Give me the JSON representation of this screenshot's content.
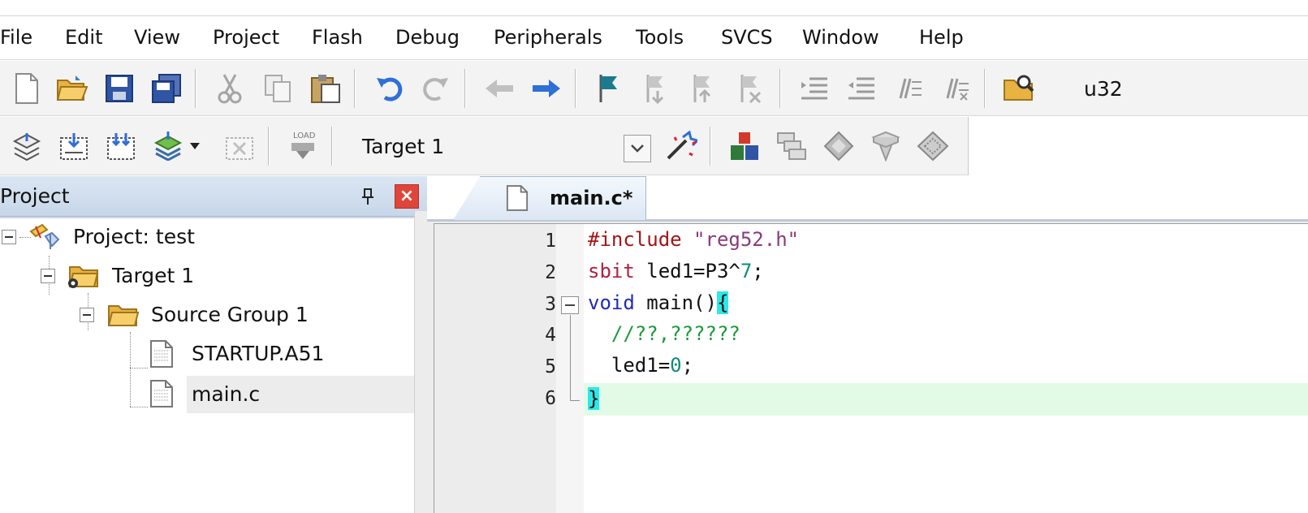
{
  "menu": {
    "items": [
      "File",
      "Edit",
      "View",
      "Project",
      "Flash",
      "Debug",
      "Peripherals",
      "Tools",
      "SVCS",
      "Window",
      "Help"
    ]
  },
  "toolbar1": {
    "find_text": "u32",
    "icons": [
      "new-file-icon",
      "open-file-icon",
      "save-icon",
      "save-all-icon",
      "cut-icon",
      "copy-icon",
      "paste-icon",
      "undo-icon",
      "redo-icon",
      "navigate-back-icon",
      "navigate-forward-icon",
      "bookmark-icon",
      "prev-bookmark-icon",
      "next-bookmark-icon",
      "clear-bookmarks-icon",
      "indent-icon",
      "unindent-icon",
      "comment-icon",
      "uncomment-icon",
      "find-in-files-icon"
    ]
  },
  "toolbar2": {
    "target": "Target 1",
    "icons": [
      "translate-icon",
      "build-icon",
      "rebuild-icon",
      "batch-build-icon",
      "stop-build-icon",
      "download-icon",
      "target-options-icon",
      "manage-components-icon",
      "file-extensions-icon",
      "select-packs-icon",
      "pack-installer-icon",
      "debug-config-icon"
    ]
  },
  "project_panel": {
    "title": "Project",
    "close_glyph": "×",
    "tree": [
      {
        "label": "Project: test"
      },
      {
        "label": "Target 1"
      },
      {
        "label": "Source Group 1"
      },
      {
        "label": "STARTUP.A51"
      },
      {
        "label": "main.c"
      }
    ]
  },
  "editor": {
    "tab_label": "main.c*",
    "line_numbers": [
      "1",
      "2",
      "3",
      "4",
      "5",
      "6"
    ],
    "lines": {
      "l1_pre": "#include",
      "l1_str": " \"reg52.h\"",
      "l2_kw": "sbit",
      "l2_a": " led1=P3^",
      "l2_num": "7",
      "l2_b": ";",
      "l3_kw": "void",
      "l3_a": " main()",
      "l3_brace": "{",
      "l4_cmt": "  //??,??????",
      "l5_a": "  led1=",
      "l5_num": "0",
      "l5_b": ";",
      "l6_brace": "}"
    }
  },
  "colors": {
    "current_line": "#e2fbe6",
    "brace_match": "#2ee8e8",
    "keyword": "#1f2bb8",
    "comment": "#1c9a3c"
  }
}
